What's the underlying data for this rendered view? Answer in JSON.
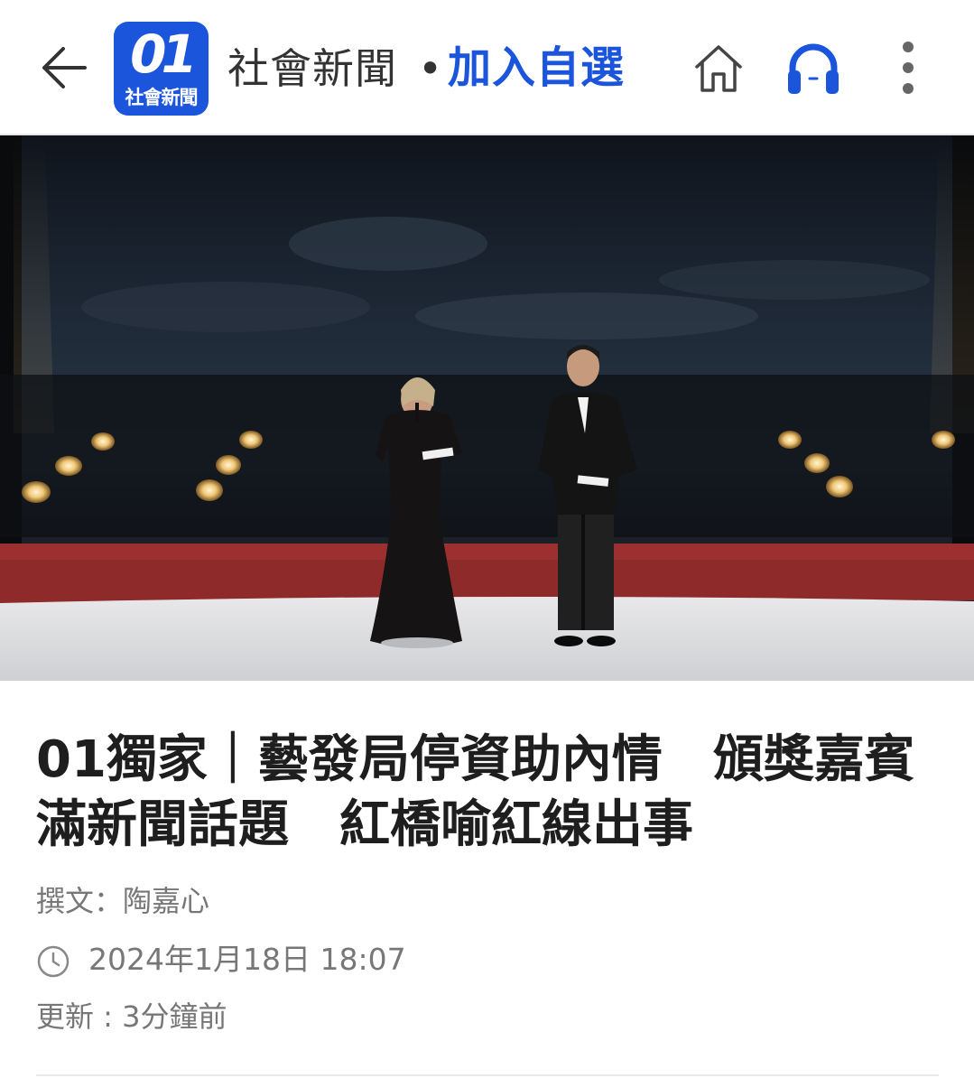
{
  "header": {
    "back_icon": "arrow-left-icon",
    "logo": {
      "number": "01",
      "subtitle": "社會新聞"
    },
    "channel_name": "社會新聞",
    "separator": "•",
    "follow_label": "加入自選",
    "home_icon": "home-icon",
    "audio_icon": "headphones-icon",
    "more_icon": "more-vertical-icon",
    "accent_color": "#1a55dc"
  },
  "hero": {
    "description_icon": "stage-photo"
  },
  "article": {
    "headline": "01獨家｜藝發局停資助內情　頒獎嘉賓\n滿新聞話題　紅橋喻紅線出事",
    "author": "撰文：陶嘉心",
    "date": "2024年1月18日 18:07",
    "updated": "更新 : 3分鐘前"
  }
}
